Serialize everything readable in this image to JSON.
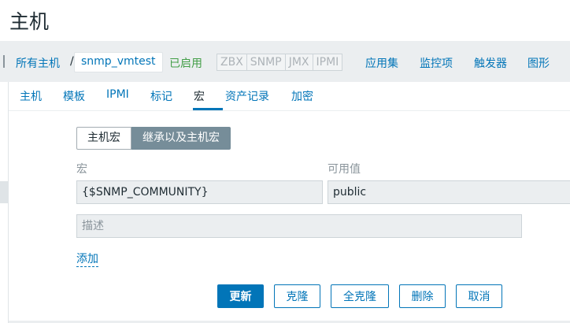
{
  "page": {
    "title": "主机"
  },
  "breadcrumb": {
    "all_hosts": "所有主机",
    "separator": "/",
    "current": "snmp_vmtest"
  },
  "status": {
    "enabled": "已启用"
  },
  "badges": [
    "ZBX",
    "SNMP",
    "JMX",
    "IPMI"
  ],
  "nav_links": {
    "applications": "应用集",
    "items": "监控项",
    "triggers": "触发器",
    "graphs": "图形"
  },
  "tabs": [
    {
      "label": "主机"
    },
    {
      "label": "模板"
    },
    {
      "label": "IPMI"
    },
    {
      "label": "标记"
    },
    {
      "label": "宏",
      "active": true
    },
    {
      "label": "资产记录"
    },
    {
      "label": "加密"
    }
  ],
  "macro_mode": {
    "host_macros": "主机宏",
    "inherited_and_host_macros": "继承以及主机宏",
    "selected": "继承以及主机宏"
  },
  "columns": {
    "macro": "宏",
    "effective_value": "可用值"
  },
  "macro_row": {
    "macro": "{$SNMP_COMMUNITY}",
    "value": "public",
    "description_placeholder": "描述"
  },
  "add_label": "添加",
  "buttons": {
    "update": "更新",
    "clone": "克隆",
    "full_clone": "全克隆",
    "delete": "删除",
    "cancel": "取消"
  },
  "colors": {
    "link": "#0275b8",
    "enabled": "#429e47",
    "selected_segment": "#768d99",
    "background": "#ebeef0"
  }
}
